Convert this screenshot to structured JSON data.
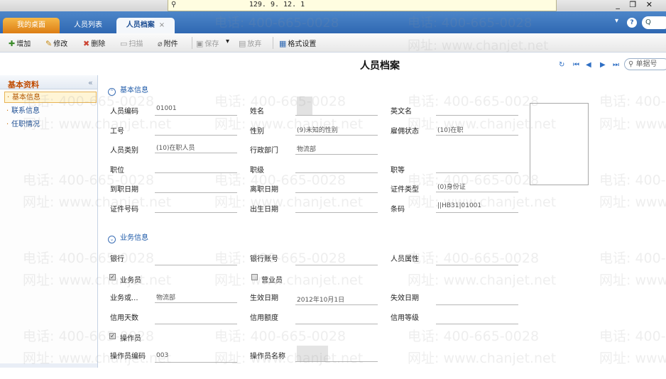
{
  "window": {
    "ip": "129. 9. 12. 1",
    "pin_glyph": "⚲",
    "controls": "_ ❐ ✕"
  },
  "tabs": {
    "desktop": "我的桌面",
    "list": "人员列表",
    "active": "人员档案",
    "close": "×"
  },
  "global": {
    "menu_glyph": "▾",
    "help": "?",
    "search_icon": "🔍",
    "search_text": "Q"
  },
  "toolbar": {
    "add": "增加",
    "edit": "修改",
    "delete": "删除",
    "scan": "扫描",
    "attach": "附件",
    "save": "保存",
    "save_arrow": "▾",
    "discard": "放弃",
    "format": "格式设置"
  },
  "header": {
    "title": "人员档案",
    "doc_search_placeholder": "单据号"
  },
  "sidebar": {
    "title": "基本资料",
    "collapse": "«",
    "items": [
      "基本信息",
      "联系信息",
      "任职情况"
    ]
  },
  "basic": {
    "section": "基本信息",
    "toggle_glyph": "⌃",
    "person_code_label": "人员编码",
    "person_code": "01001",
    "name_label": "姓名",
    "english_name_label": "英文名",
    "work_no_label": "工号",
    "gender_label": "性别",
    "gender": "(9)未知的性别",
    "employ_status_label": "雇佣状态",
    "employ_status": "(10)在职",
    "person_type_label": "人员类别",
    "person_type": "(10)在职人员",
    "admin_dept_label": "行政部门",
    "admin_dept": "物流部",
    "position_label": "职位",
    "rank_label": "职级",
    "grade_label": "职等",
    "onboard_label": "到职日期",
    "leave_label": "离职日期",
    "id_type_label": "证件类型",
    "id_type": "(0)身份证",
    "id_no_label": "证件号码",
    "birth_label": "出生日期",
    "barcode_label": "条码",
    "barcode": "||HB31|01001"
  },
  "business": {
    "section": "业务信息",
    "toggle_glyph": "⌄",
    "bank_label": "银行",
    "bank_account_label": "银行账号",
    "person_attr_label": "人员属性",
    "salesman_label": "业务员",
    "salesman_check": "✓",
    "clerk_label": "营业员",
    "biz_dept_label": "业务或...",
    "biz_dept": "物流部",
    "effective_label": "生效日期",
    "effective": "2012年10月1日",
    "expire_label": "失效日期",
    "credit_days_label": "信用天数",
    "credit_amount_label": "信用额度",
    "credit_level_label": "信用等级",
    "operator_label": "操作员",
    "operator_check": "✓",
    "operator_code_label": "操作员编码",
    "operator_code": "003",
    "operator_name_label": "操作员名称"
  },
  "watermark": {
    "phone": "电话: 400-665-0028",
    "site": "网址: www.chanjet.net"
  },
  "colors": {
    "tab_blue": "#2f68b2",
    "tab_orange": "#dc7d14",
    "section_blue": "#1e5aa8",
    "sidebar_title": "#c04b00"
  }
}
